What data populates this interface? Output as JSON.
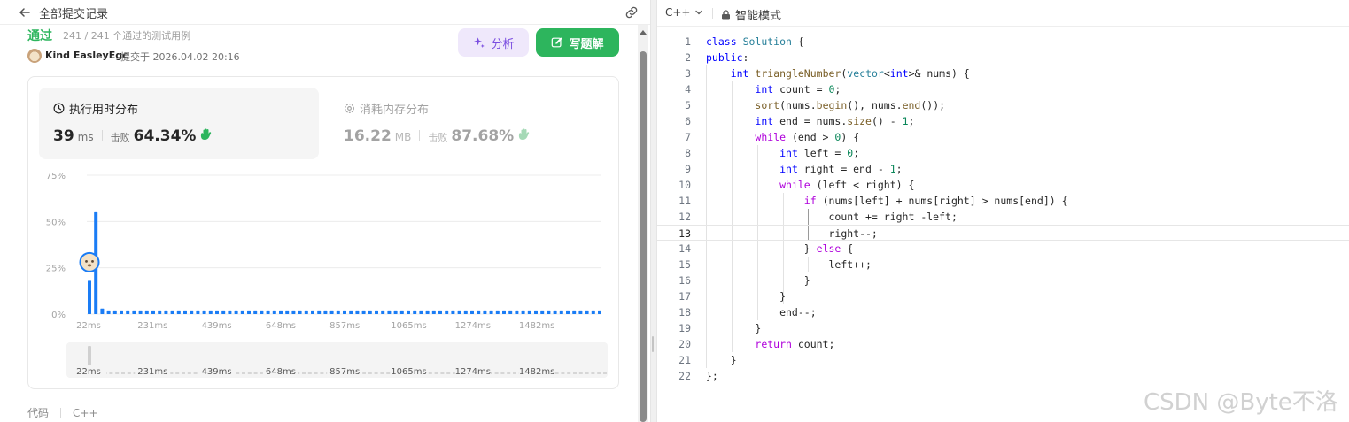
{
  "header": {
    "title": "全部提交记录"
  },
  "submission": {
    "status": "通过",
    "test_count": "241 / 241 个通过的测试用例",
    "username": "Kind EasleyEgc",
    "submitted_at": "提交于 2026.04.02 20:16"
  },
  "buttons": {
    "analyze": "分析",
    "write_solution": "写题解"
  },
  "runtime": {
    "title": "执行用时分布",
    "value": "39",
    "unit": "ms",
    "beat_label": "击败",
    "beat_pct": "64.34%"
  },
  "memory": {
    "title": "消耗内存分布",
    "value": "16.22",
    "unit": "MB",
    "beat_label": "击败",
    "beat_pct": "87.68%"
  },
  "chart_data": {
    "type": "bar",
    "title": "",
    "xlabel": "",
    "ylabel": "",
    "y_ticks": [
      "75%",
      "50%",
      "25%",
      "0%"
    ],
    "x_ticks": [
      "22ms",
      "231ms",
      "439ms",
      "648ms",
      "857ms",
      "1065ms",
      "1274ms",
      "1482ms"
    ],
    "ylim": [
      0,
      75
    ],
    "x": [
      "22ms",
      "32ms",
      "42ms"
    ],
    "values": [
      18,
      55,
      3
    ],
    "baseline_value": 2,
    "baseline_bar_count": 78,
    "user_marker_value": 28,
    "bar_color": "#1a7cf5"
  },
  "footer": {
    "label": "代码",
    "language": "C++"
  },
  "editor": {
    "language": "C++",
    "mode": "智能模式",
    "line_numbers": [
      "1",
      "2",
      "3",
      "4",
      "5",
      "6",
      "7",
      "8",
      "9",
      "10",
      "11",
      "12",
      "13",
      "14",
      "15",
      "16",
      "17",
      "18",
      "19",
      "20",
      "21",
      "22"
    ],
    "current_line": 13
  },
  "watermark": "CSDN @Byte不洛",
  "colors": {
    "accent_green": "#2db55d",
    "accent_purple": "#7b4ee0",
    "chart_blue": "#1a7cf5"
  }
}
